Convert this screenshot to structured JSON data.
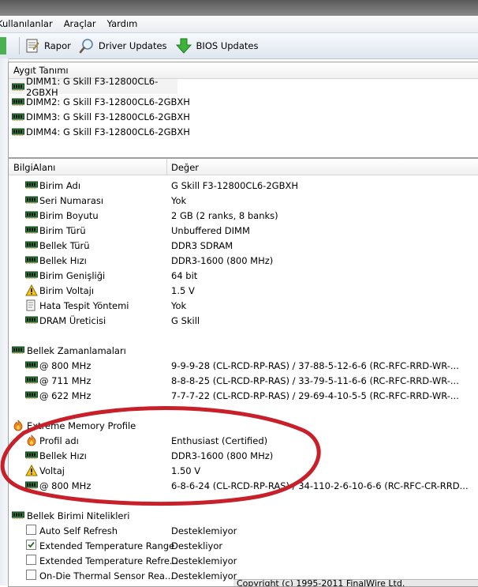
{
  "menu": [
    "Kullanılanlar",
    "Araçlar",
    "Yardım"
  ],
  "toolbar": {
    "report": "Rapor",
    "driver_updates": "Driver Updates",
    "bios_updates": "BIOS Updates"
  },
  "device_panel": {
    "header": "Aygıt Tanımı",
    "items": [
      "DIMM1: G Skill F3-12800CL6-2GBXH",
      "DIMM2: G Skill F3-12800CL6-2GBXH",
      "DIMM3: G Skill F3-12800CL6-2GBXH",
      "DIMM4: G Skill F3-12800CL6-2GBXH"
    ]
  },
  "info_panel": {
    "col_field": "BilgiAlanı",
    "col_value": "Değer",
    "module_props": [
      {
        "label": "Birim Adı",
        "value": "G Skill F3-12800CL6-2GBXH",
        "icon": "memory-icon"
      },
      {
        "label": "Seri Numarası",
        "value": "Yok",
        "icon": "memory-icon"
      },
      {
        "label": "Birim Boyutu",
        "value": "2 GB (2 ranks, 8 banks)",
        "icon": "memory-icon"
      },
      {
        "label": "Birim Türü",
        "value": "Unbuffered DIMM",
        "icon": "memory-icon"
      },
      {
        "label": "Bellek Türü",
        "value": "DDR3 SDRAM",
        "icon": "memory-icon"
      },
      {
        "label": "Bellek Hızı",
        "value": "DDR3-1600 (800 MHz)",
        "icon": "memory-icon"
      },
      {
        "label": "Birim Genişliği",
        "value": "64 bit",
        "icon": "memory-icon"
      },
      {
        "label": "Birim Voltajı",
        "value": "1.5 V",
        "icon": "warning-icon"
      },
      {
        "label": "Hata Tespit Yöntemi",
        "value": "Yok",
        "icon": "document-icon"
      },
      {
        "label": "DRAM Üreticisi",
        "value": "G Skill",
        "icon": "memory-icon"
      }
    ],
    "timings_section": "Bellek Zamanlamaları",
    "timings": [
      {
        "label": "@ 800 MHz",
        "value": "9-9-9-28  (CL-RCD-RP-RAS) / 37-88-5-12-6-6  (RC-RFC-RRD-WR-..."
      },
      {
        "label": "@ 711 MHz",
        "value": "8-8-8-25  (CL-RCD-RP-RAS) / 33-79-5-11-6-6  (RC-RFC-RRD-WR-..."
      },
      {
        "label": "@ 622 MHz",
        "value": "7-7-7-22  (CL-RCD-RP-RAS) / 29-69-4-10-5-5  (RC-RFC-RRD-WR-..."
      }
    ],
    "xmp_section": "Extreme Memory Profile",
    "xmp": [
      {
        "label": "Profil adı",
        "value": "Enthusiast (Certified)",
        "icon": "flame-icon"
      },
      {
        "label": "Bellek Hızı",
        "value": "DDR3-1600 (800 MHz)",
        "icon": "memory-icon"
      },
      {
        "label": "Voltaj",
        "value": "1.50 V",
        "icon": "warning-icon"
      },
      {
        "label": "@ 800 MHz",
        "value": "6-8-6-24  (CL-RCD-RP-RAS) / 34-110-2-6-10-6-6  (RC-RFC-CR-RRD...",
        "icon": "memory-icon"
      }
    ],
    "features_section": "Bellek Birimi Nitelikleri",
    "features": [
      {
        "label": "Auto Self Refresh",
        "value": "Desteklemiyor",
        "checked": false
      },
      {
        "label": "Extended Temperature Range",
        "value": "Destekliyor",
        "checked": true
      },
      {
        "label": "Extended Temperature Refre...",
        "value": "Desteklemiyor",
        "checked": false
      },
      {
        "label": "On-Die Thermal Sensor Rea...",
        "value": "Desteklemiyor",
        "checked": false
      }
    ]
  },
  "status": "Copyright (c) 1995-2011 FinalWire Ltd.",
  "colors": {
    "annotation": "#c8202a",
    "selection": "#f3f3f3"
  }
}
